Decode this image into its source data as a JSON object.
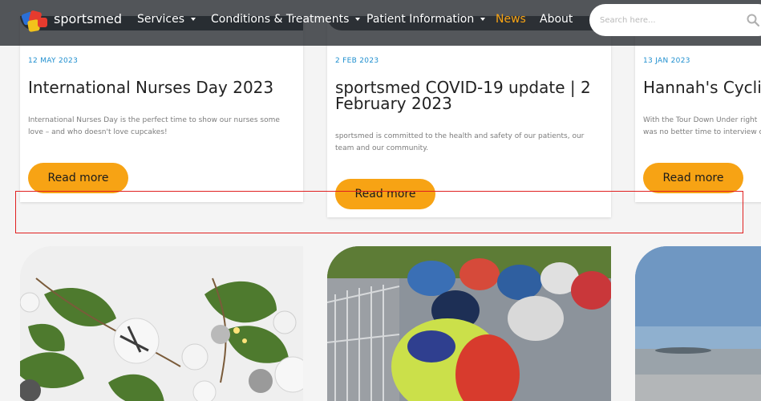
{
  "header": {
    "logo_text": "sportsmed",
    "nav": [
      {
        "label": "Services",
        "has_dropdown": true
      },
      {
        "label": "Conditions & Treatments",
        "has_dropdown": true
      },
      {
        "label": "Patient Information",
        "has_dropdown": true
      },
      {
        "label": "News",
        "active": true
      },
      {
        "label": "About"
      }
    ],
    "search": {
      "placeholder": "Search here..."
    },
    "colors": {
      "accent": "#f7a314",
      "header_bg": "#24282d"
    }
  },
  "posts": [
    {
      "date": "12 MAY 2023",
      "title": "International Nurses Day 2023",
      "excerpt": "International Nurses Day is the perfect time to show our nurses some love – and who doesn't love cupcakes!",
      "button": "Read more"
    },
    {
      "date": "2 FEB 2023",
      "title": "sportsmed COVID-19 update | 2 February 2023",
      "excerpt": "sportsmed is committed to the health and safety of our patients, our team and our community.",
      "button": "Read more"
    },
    {
      "date": "13 JAN 2023",
      "title": "Hannah's Cycling",
      "excerpt_lines": [
        "With the Tour Down Under right",
        "was no better time to interview c"
      ],
      "button": "Read more"
    }
  ],
  "images": [
    {
      "subject": "christmas bells and leaves"
    },
    {
      "subject": "cycling race"
    },
    {
      "subject": "beach shoreline"
    }
  ]
}
